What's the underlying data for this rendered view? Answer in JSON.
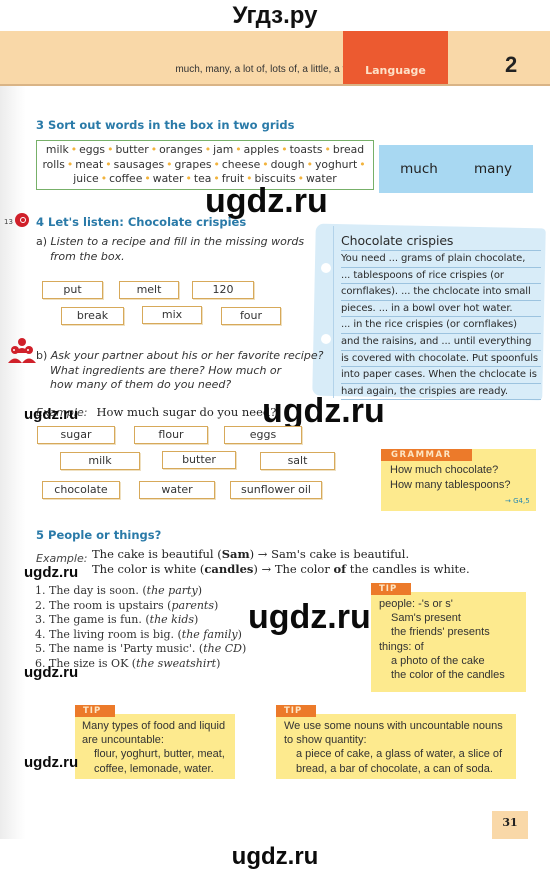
{
  "site": {
    "title": "Угдз.ру",
    "watermark": "ugdz.ru"
  },
  "header": {
    "topic": "much, many, a lot of, lots of, a little, a few",
    "section": "Language",
    "unit_number": "2"
  },
  "exercise3": {
    "number": "3",
    "title": "Sort out words in the box in two grids",
    "word_lines": [
      [
        "milk",
        "eggs",
        "butter",
        "oranges",
        "jam",
        "apples",
        "toasts",
        "bread"
      ],
      [
        "rolls",
        "meat",
        "sausages",
        "grapes",
        "cheese",
        "dough",
        "yoghurt",
        ""
      ],
      [
        "juice",
        "coffee",
        "water",
        "tea",
        "fruit",
        "biscuits",
        "water"
      ]
    ],
    "grids": [
      "much",
      "many"
    ]
  },
  "exercise4": {
    "track": "13",
    "number": "4",
    "title": "Let's listen: Chocolate crispies",
    "part_a": {
      "label": "a)",
      "instruction_lines": [
        "Listen to a recipe and fill in the missing words",
        "from the box."
      ],
      "chips": [
        "put",
        "melt",
        "120",
        "break",
        "mix",
        "four"
      ]
    },
    "recipe_card": {
      "title": "Chocolate crispies",
      "lines": [
        "You need ... grams of plain chocolate,",
        "... tablespoons of rice crispies (or",
        "cornflakes). ... the chclocate into small",
        "pieces. ... in a bowl over hot water.",
        "... in the rice crispies (or cornflakes)",
        "and the raisins, and ... until everything",
        "is covered with chocolate. Put spoonfuls",
        "into paper cases. When the chclocate is",
        "hard again, the crispies are ready."
      ]
    },
    "part_b": {
      "label": "b)",
      "instruction_lines": [
        "Ask your partner about his or her favorite recipe?",
        "What ingredients are there? How much or",
        "how many of them do you need?"
      ],
      "example_label": "Example:",
      "example_text": "How much sugar do you need?",
      "chips": [
        "sugar",
        "flour",
        "eggs",
        "milk",
        "butter",
        "salt",
        "chocolate",
        "water",
        "sunflower oil"
      ]
    },
    "grammar": {
      "tag": "GRAMMAR",
      "lines": [
        "How much chocolate?",
        "How many tablespoons?"
      ],
      "ref": "→ G4,5"
    }
  },
  "exercise5": {
    "number": "5",
    "title": "People or things?",
    "example_label": "Example:",
    "examples": [
      {
        "pre": "The cake is beautiful (",
        "bold": "Sam",
        "post": ") → Sam's cake is beautiful."
      },
      {
        "pre": "The color is white (",
        "bold": "candles",
        "post": ") → The color ",
        "bold2": "of",
        "post2": " the candles is white."
      }
    ],
    "items": [
      {
        "num": "1.",
        "text": "The day is soon. (",
        "hint": "the party",
        "end": ")"
      },
      {
        "num": "2.",
        "text": "The room is upstairs (",
        "hint": "parents",
        "end": ")"
      },
      {
        "num": "3.",
        "text": "The game is fun. (",
        "hint": "the kids",
        "end": ")"
      },
      {
        "num": "4.",
        "text": "The living room is big. (",
        "hint": "the family",
        "end": ")"
      },
      {
        "num": "5.",
        "text": "The name is 'Party music'. (",
        "hint": "the CD",
        "end": ")"
      },
      {
        "num": "6.",
        "text": "The size is OK (",
        "hint": "the sweatshirt",
        "end": ")"
      }
    ],
    "tip": {
      "tag": "TIP",
      "lines": [
        {
          "text": "people: -'s or  s'",
          "indent": false
        },
        {
          "text": "Sam's present",
          "indent": true
        },
        {
          "text": "the friends' presents",
          "indent": true
        },
        {
          "text": "things: of",
          "indent": false
        },
        {
          "text": "a photo of the cake",
          "indent": true
        },
        {
          "text": "the color of the candles",
          "indent": true
        }
      ]
    }
  },
  "tips_bottom": [
    {
      "tag": "TIP",
      "lines": [
        {
          "text": "Many types of food and liquid",
          "indent": false
        },
        {
          "text": "are uncountable:",
          "indent": false
        },
        {
          "text": "flour, yoghurt, butter, meat,",
          "indent": true
        },
        {
          "text": "coffee, lemonade, water.",
          "indent": true
        }
      ]
    },
    {
      "tag": "TIP",
      "lines": [
        {
          "text": "We use some nouns with uncountable nouns",
          "indent": false
        },
        {
          "text": "to show quantity:",
          "indent": false
        },
        {
          "text": "a piece of cake, a glass of water, a slice of",
          "indent": true
        },
        {
          "text": "bread, a bar of chocolate, a can of soda.",
          "indent": true
        }
      ]
    }
  ],
  "page_number": "31",
  "colors": {
    "header_band": "#f9d8a8",
    "language_tab": "#ec5a30",
    "exercise_title": "#2a7aa8",
    "wordbox_border": "#77b069",
    "grid_box": "#a8d8f2",
    "chip_border": "#d7a95a",
    "tip_box": "#fdea8e",
    "tip_tag": "#ec7a2a",
    "note_card": "#d8ecf8"
  }
}
